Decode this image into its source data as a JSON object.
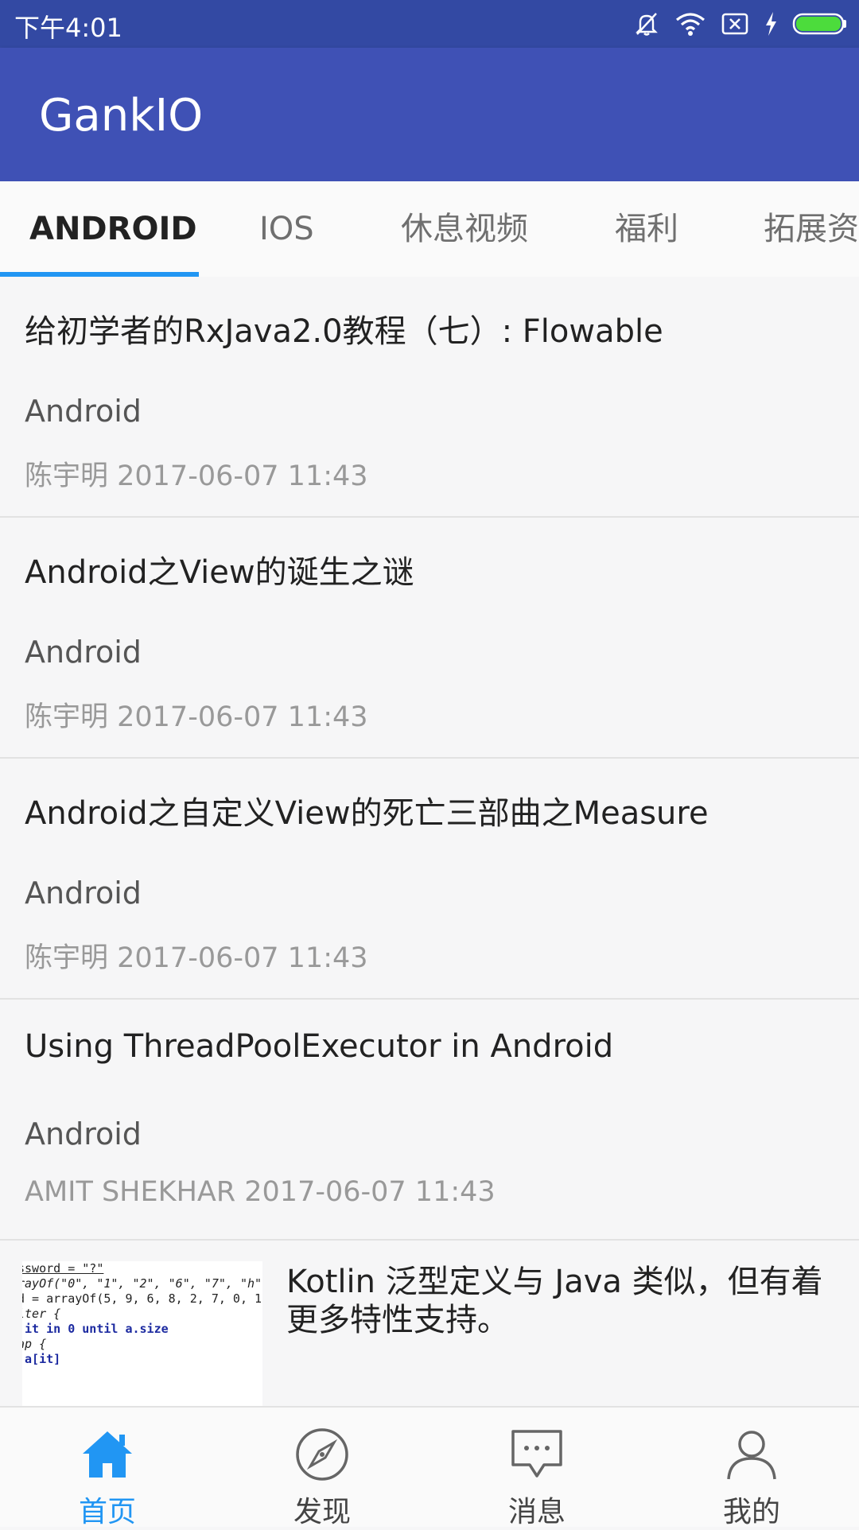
{
  "status_bar": {
    "time": "下午4:01"
  },
  "app_bar": {
    "title": "GankIO"
  },
  "tabs": [
    {
      "label": "ANDROID"
    },
    {
      "label": "IOS"
    },
    {
      "label": "休息视频"
    },
    {
      "label": "福利"
    },
    {
      "label": "拓展资源"
    }
  ],
  "feed": {
    "items": [
      {
        "title": "给初学者的RxJava2.0教程（七）: Flowable",
        "type": "Android",
        "meta": "陈宇明 2017-06-07 11:43"
      },
      {
        "title": "Android之View的诞生之谜",
        "type": "Android",
        "meta": "陈宇明 2017-06-07 11:43"
      },
      {
        "title": "Android之自定义View的死亡三部曲之Measure",
        "type": "Android",
        "meta": "陈宇明 2017-06-07 11:43"
      },
      {
        "title": "Using ThreadPoolExecutor in Android",
        "type": "Android",
        "meta": "AMIT SHEKHAR 2017-06-07 11:43"
      }
    ],
    "image_item": {
      "text": "Kotlin 泛型定义与 Java 类似，但有着更多特性支持。",
      "code_lines": [
        "ssword = \"?\"",
        "",
        "rayOf(\"0\", \"1\", \"2\", \"6\", \"7\", \"h\",",
        "d = arrayOf(5, 9, 6, 8, 2, 7, 0, 1",
        "lter {",
        " it in 0 until a.size",
        "",
        "ap {",
        " a[it]"
      ]
    }
  },
  "bottom_nav": [
    {
      "label": "首页",
      "icon": "home-icon",
      "active": true
    },
    {
      "label": "发现",
      "icon": "compass-icon",
      "active": false
    },
    {
      "label": "消息",
      "icon": "message-icon",
      "active": false
    },
    {
      "label": "我的",
      "icon": "person-icon",
      "active": false
    }
  ],
  "colors": {
    "primary": "#3f51b5",
    "status_bar": "#3349a3",
    "accent": "#2196f3"
  }
}
